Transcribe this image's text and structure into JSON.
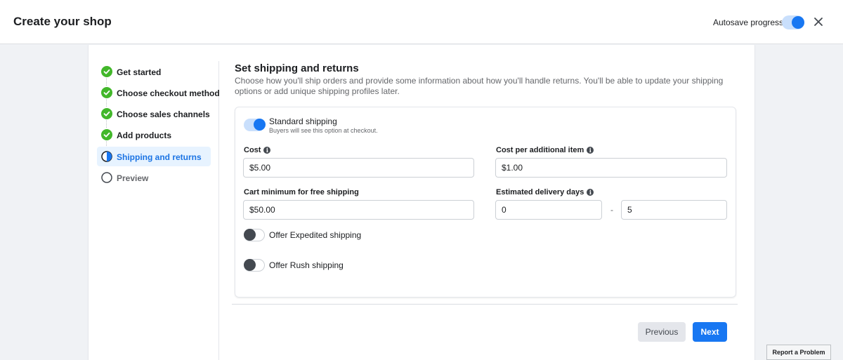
{
  "header": {
    "title": "Create your shop",
    "autosave_label": "Autosave progress",
    "autosave_on": true,
    "close_icon": "close-icon"
  },
  "steps": [
    {
      "label": "Get started",
      "status": "complete",
      "icon": "check-circle-icon"
    },
    {
      "label": "Choose checkout method",
      "status": "complete",
      "icon": "check-circle-icon"
    },
    {
      "label": "Choose sales channels",
      "status": "complete",
      "icon": "check-circle-icon"
    },
    {
      "label": "Add products",
      "status": "complete",
      "icon": "check-circle-icon"
    },
    {
      "label": "Shipping and returns",
      "status": "current",
      "icon": "half-circle-icon"
    },
    {
      "label": "Preview",
      "status": "pending",
      "icon": "empty-circle-icon"
    }
  ],
  "main": {
    "title": "Set shipping and returns",
    "description": "Choose how you'll ship orders and provide some information about how you'll handle returns. You'll be able to update your shipping options or add unique shipping profiles later.",
    "standard_shipping": {
      "label": "Standard shipping",
      "sublabel": "Buyers will see this option at checkout.",
      "enabled": true
    },
    "fields": {
      "cost": {
        "label": "Cost",
        "value": "$5.00",
        "info_icon": "info-icon"
      },
      "cost_additional": {
        "label": "Cost per additional item",
        "value": "$1.00",
        "info_icon": "info-icon"
      },
      "cart_minimum": {
        "label": "Cart minimum for free shipping",
        "value": "$50.00"
      },
      "delivery_days": {
        "label": "Estimated delivery days",
        "min": "0",
        "max": "5",
        "separator": "-",
        "info_icon": "info-icon"
      }
    },
    "expedited": {
      "label": "Offer Expedited shipping",
      "enabled": false
    },
    "rush": {
      "label": "Offer Rush shipping",
      "enabled": false
    }
  },
  "footer": {
    "previous_label": "Previous",
    "next_label": "Next"
  },
  "report_label": "Report a Problem",
  "colors": {
    "accent": "#1877f2",
    "complete_green": "#42b72a",
    "active_bg": "#e7f3ff"
  }
}
